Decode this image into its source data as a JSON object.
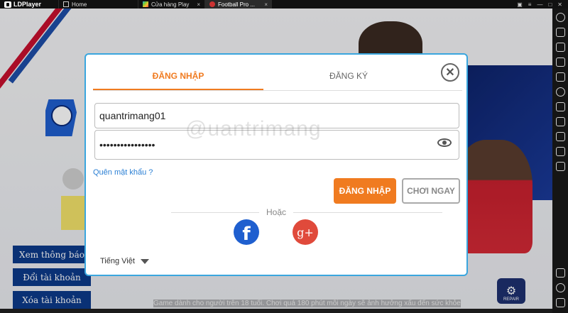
{
  "titlebar": {
    "app_name": "LDPlayer",
    "tabs": [
      {
        "label": "Home",
        "active": false
      },
      {
        "label": "Cửa hàng Play",
        "active": false
      },
      {
        "label": "Football Pro ...",
        "active": true
      }
    ],
    "window_controls": [
      "gamepad-icon",
      "menu-icon",
      "minimize-icon",
      "maximize-icon",
      "close-icon"
    ]
  },
  "sidebar": {
    "icons": [
      "settings-icon",
      "keyboard-icon",
      "volume-up-icon",
      "volume-down-icon",
      "fullscreen-icon",
      "screen-rotate-icon",
      "apk-install-icon",
      "record-icon",
      "rpk-icon",
      "screenshot-icon",
      "more-icon"
    ],
    "bottom_icons": [
      "back-icon",
      "home-icon",
      "recent-icon"
    ]
  },
  "game": {
    "side_buttons": [
      "Xem thông báo",
      "Đổi tài khoản",
      "Xóa tài khoản"
    ],
    "footer_text": "Game dành cho người trên 18 tuổi. Chơi quá 180 phút mỗi ngày sẽ ảnh hưởng xấu đến sức khỏe",
    "repair_label": "REPAIR"
  },
  "modal": {
    "tab_login": "ĐĂNG NHẬP",
    "tab_register": "ĐĂNG KÝ",
    "username_value": "quantrimang01",
    "password_value": "••••••••••••••••",
    "forgot_password": "Quên mật khẩu ?",
    "login_button": "ĐĂNG NHẬP",
    "play_now_button": "CHƠI NGAY",
    "or_text": "Hoặc",
    "facebook_glyph": "f",
    "google_glyph": "g+",
    "language": "Tiếng Việt"
  },
  "watermark": "@uantrimang",
  "colors": {
    "accent_orange": "#f07b20",
    "modal_border": "#3aa6de",
    "facebook": "#1f5fcf",
    "google": "#e04a3b",
    "link": "#2a7fd4"
  }
}
